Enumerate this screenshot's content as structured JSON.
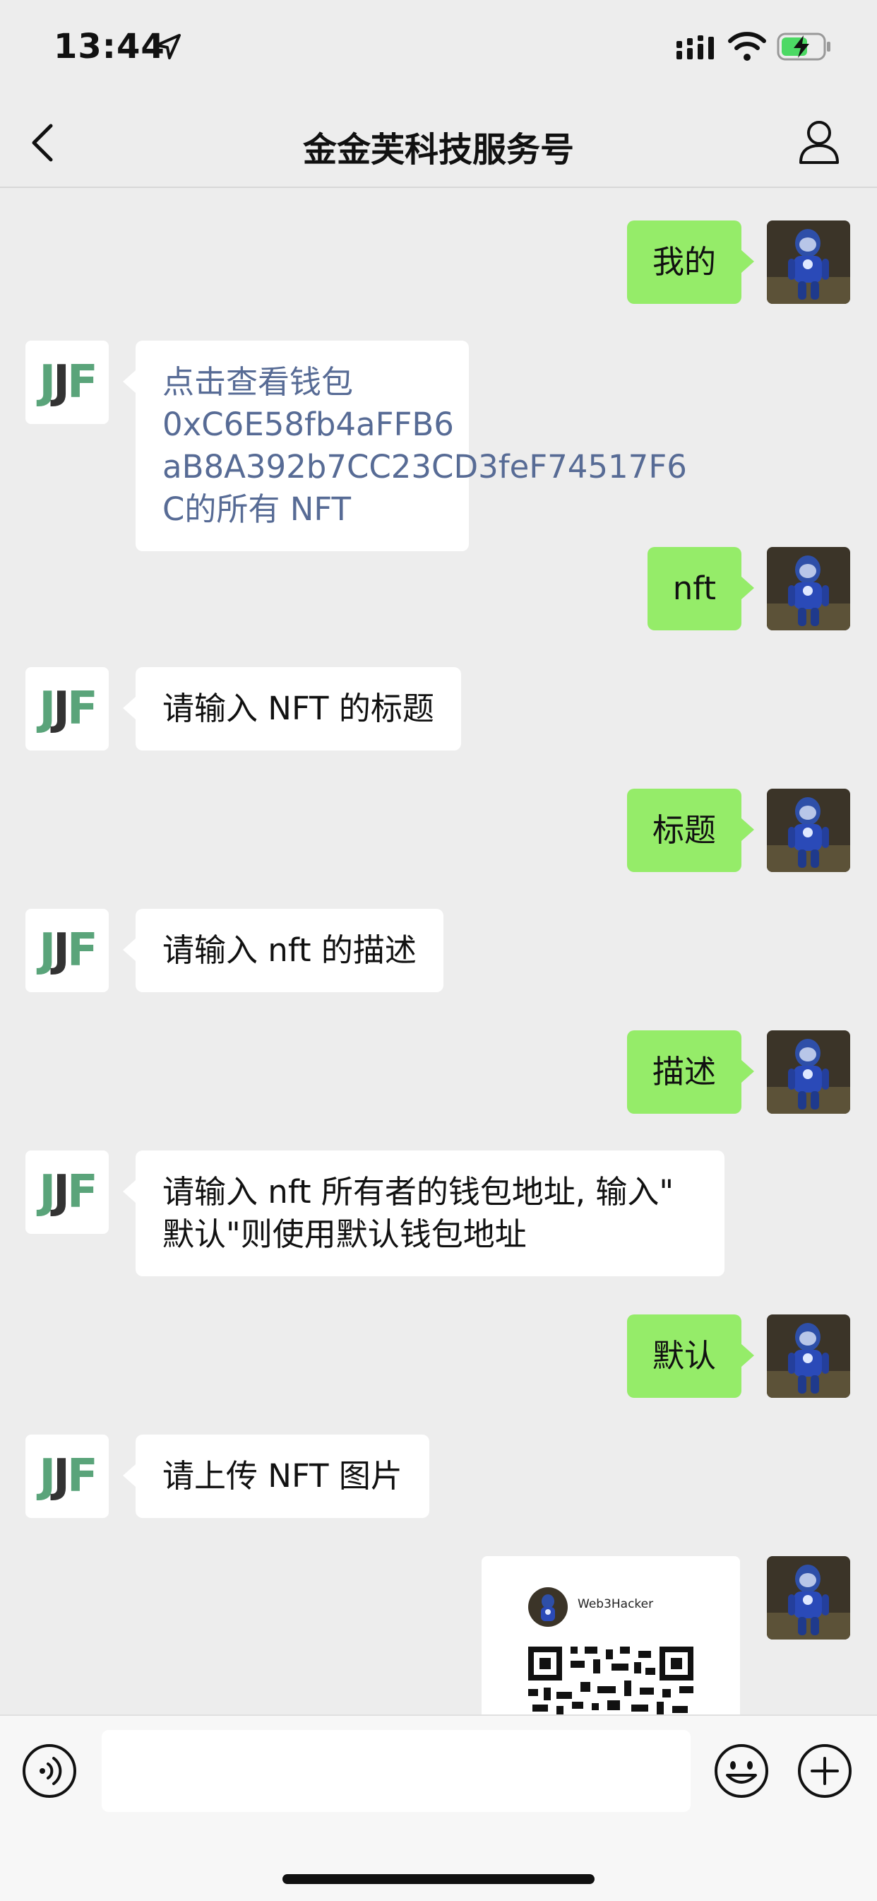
{
  "status_bar": {
    "time": "13:44"
  },
  "header": {
    "title": "金金芙科技服务号"
  },
  "bot_avatar": {
    "j1": "J",
    "j2": "J",
    "f": "F"
  },
  "messages": [
    {
      "from": "me",
      "text": "我的"
    },
    {
      "from": "bot",
      "text": "点击查看钱包 0xC6E58fb4aFFB6aB8A392b7CC23CD3feF74517F6C的所有 NFT",
      "lines": [
        "点击查看钱包 0xC6E58fb4aFFB6",
        "aB8A392b7CC23CD3feF74517F6",
        "C的所有 NFT"
      ]
    },
    {
      "from": "me",
      "text": "nft"
    },
    {
      "from": "bot",
      "text": "请输入 NFT 的标题"
    },
    {
      "from": "me",
      "text": "标题"
    },
    {
      "from": "bot",
      "text": "请输入 nft 的描述"
    },
    {
      "from": "me",
      "text": "描述"
    },
    {
      "from": "bot",
      "text": "请输入 nft 所有者的钱包地址, 输入\"默认\"则使用默认钱包地址",
      "lines": [
        "请输入 nft 所有者的钱包地址, 输入\"",
        "默认\"则使用默认钱包地址"
      ]
    },
    {
      "from": "me",
      "text": "默认"
    },
    {
      "from": "bot",
      "text": "请上传 NFT 图片"
    }
  ],
  "image_message": {
    "username": "Web3Hacker"
  },
  "colors": {
    "me_bubble": "#95ec69",
    "bot_bubble": "#ffffff",
    "link": "#576b95",
    "logo_green": "#5aa47a",
    "logo_dark": "#333333"
  }
}
